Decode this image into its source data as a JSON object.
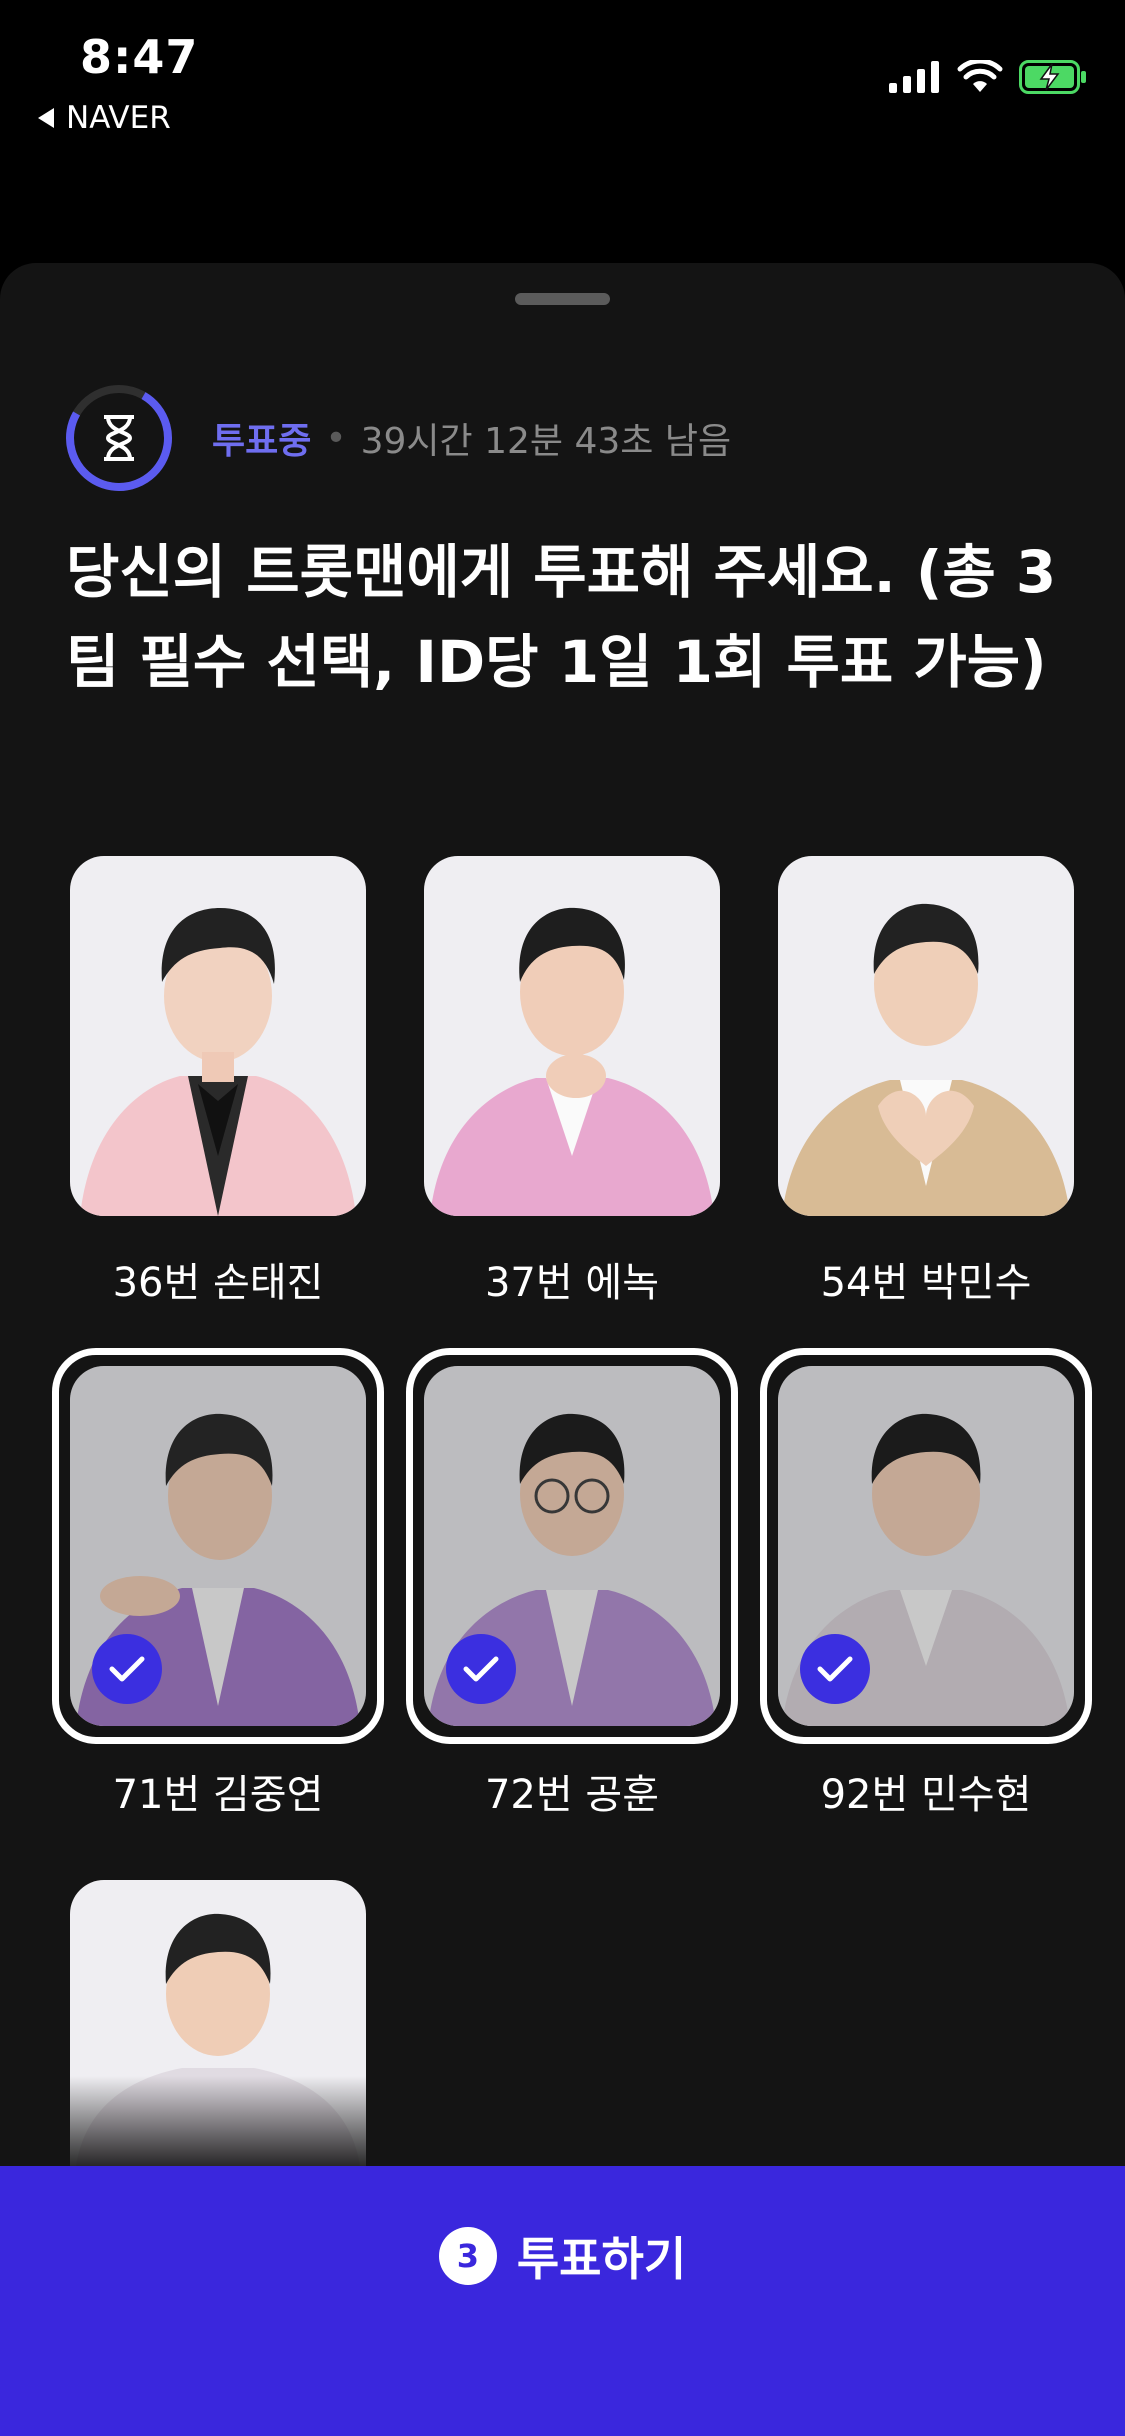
{
  "status_bar": {
    "time": "8:47",
    "back_app": "NAVER"
  },
  "vote": {
    "status": "투표중",
    "separator": "•",
    "remaining": "39시간 12분 43초 남음",
    "question": "당신의 트롯맨에게 투표해 주세요. (총 3팀 필수 선택, ID당 1일 1회 투표 가능)"
  },
  "candidates": [
    {
      "label": "36번 손태진",
      "selected": false
    },
    {
      "label": "37번 에녹",
      "selected": false
    },
    {
      "label": "54번 박민수",
      "selected": false
    },
    {
      "label": "71번 김중연",
      "selected": true
    },
    {
      "label": "72번 공훈",
      "selected": true
    },
    {
      "label": "92번 민수현",
      "selected": true
    },
    {
      "label": "",
      "selected": false
    }
  ],
  "button": {
    "count": "3",
    "label": "투표하기"
  },
  "colors": {
    "accent": "#3a27dd",
    "status_accent": "#6f6ef0",
    "sheet_bg": "#141414"
  },
  "icons": {
    "timer": "hourglass-icon",
    "check": "check-icon",
    "signal": "signal-icon",
    "wifi": "wifi-icon",
    "battery": "battery-charging-icon"
  }
}
